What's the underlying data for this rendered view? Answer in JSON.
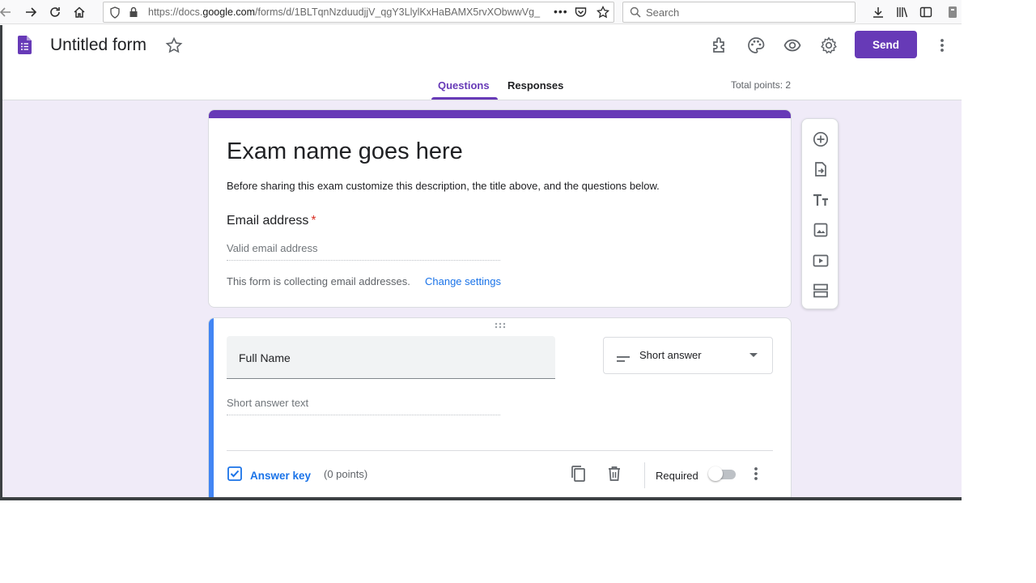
{
  "browser": {
    "url_prefix": "https://docs.",
    "url_domain": "google.com",
    "url_rest": "/forms/d/1BLTqnNzduudjjV_qgY3LlylKxHaBAMX5rvXObwwVg_",
    "search_placeholder": "Search"
  },
  "header": {
    "doc_title": "Untitled form",
    "send_label": "Send",
    "tabs": [
      {
        "label": "Questions",
        "active": true
      },
      {
        "label": "Responses",
        "active": false
      }
    ],
    "total_points": "Total points: 2",
    "accent_color": "#673ab7"
  },
  "title_card": {
    "title": "Exam name goes here",
    "description": "Before sharing this exam customize this description, the title above, and the questions below.",
    "email_label": "Email address",
    "required_marker": "*",
    "email_placeholder": "Valid email address",
    "collecting_text": "This form is collecting email addresses.",
    "change_settings_link": "Change settings"
  },
  "question_card": {
    "question_title": "Full Name",
    "type_label": "Short answer",
    "answer_placeholder": "Short answer text",
    "answer_key_label": "Answer key",
    "points_label": "(0 points)",
    "required_label": "Required",
    "required_on": false
  },
  "side_toolbar": {
    "icons": [
      "add-question-icon",
      "import-questions-icon",
      "add-title-icon",
      "add-image-icon",
      "add-video-icon",
      "add-section-icon"
    ]
  }
}
